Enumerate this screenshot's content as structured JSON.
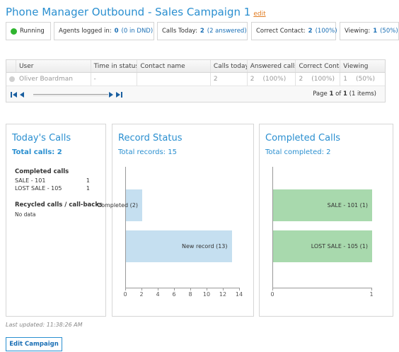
{
  "header": {
    "title": "Phone Manager Outbound - Sales Campaign 1",
    "edit_link": "edit"
  },
  "stats": {
    "running": "Running",
    "agents_label": "Agents logged in:",
    "agents_value": "0",
    "agents_sub": "(0 in DND)",
    "calls_label": "Calls Today:",
    "calls_value": "2",
    "calls_sub": "(2 answered)",
    "correct_label": "Correct Contact:",
    "correct_value": "2",
    "correct_sub": "(100%)",
    "viewing_label": "Viewing:",
    "viewing_value": "1",
    "viewing_sub": "(50%)",
    "running_color": "#2fb52f"
  },
  "grid": {
    "columns": [
      "User",
      "Time in status",
      "Contact name",
      "Calls today",
      "Answered calls",
      "Correct Contac",
      "Viewing"
    ],
    "row": {
      "user": "Oliver Boardman",
      "time": "-",
      "contact": "",
      "calls": "2",
      "answered": "2",
      "answered_pct": "(100%)",
      "correct": "2",
      "correct_pct": "(100%)",
      "viewing": "1",
      "viewing_pct": "(50%)"
    },
    "pager": {
      "page_prefix": "Page",
      "page": "1",
      "of": "of",
      "total_pages": "1",
      "items": "(1 items)"
    }
  },
  "todays_calls": {
    "title": "Today's Calls",
    "total_label": "Total calls:",
    "total_value": "2",
    "completed_heading": "Completed calls",
    "completed": [
      {
        "name": "SALE - 101",
        "count": "1"
      },
      {
        "name": "LOST SALE - 105",
        "count": "1"
      }
    ],
    "recycled_heading": "Recycled calls / call-backs",
    "recycled_empty": "No data"
  },
  "record_status": {
    "title": "Record Status",
    "subtitle": "Total records: 15",
    "bar_color": "#c5dff0"
  },
  "completed_calls": {
    "title": "Completed Calls",
    "subtitle": "Total completed: 2",
    "bar_color": "#a8d9ad"
  },
  "chart_data": [
    {
      "type": "bar",
      "orientation": "horizontal",
      "categories": [
        "Completed",
        "New record"
      ],
      "values": [
        2,
        13
      ],
      "labels": [
        "Completed (2)",
        "New record (13)"
      ],
      "xlim": [
        0,
        14
      ],
      "xticks": [
        "0",
        "2",
        "4",
        "6",
        "8",
        "10",
        "12",
        "14"
      ]
    },
    {
      "type": "bar",
      "orientation": "horizontal",
      "categories": [
        "SALE - 101",
        "LOST SALE - 105"
      ],
      "values": [
        1,
        1
      ],
      "labels": [
        "SALE - 101 (1)",
        "LOST SALE - 105 (1)"
      ],
      "xlim": [
        0,
        1
      ],
      "xticks": [
        "0",
        "1"
      ]
    }
  ],
  "footer": {
    "last_updated": "Last updated: 11:38:26 AM",
    "edit_campaign": "Edit Campaign"
  }
}
